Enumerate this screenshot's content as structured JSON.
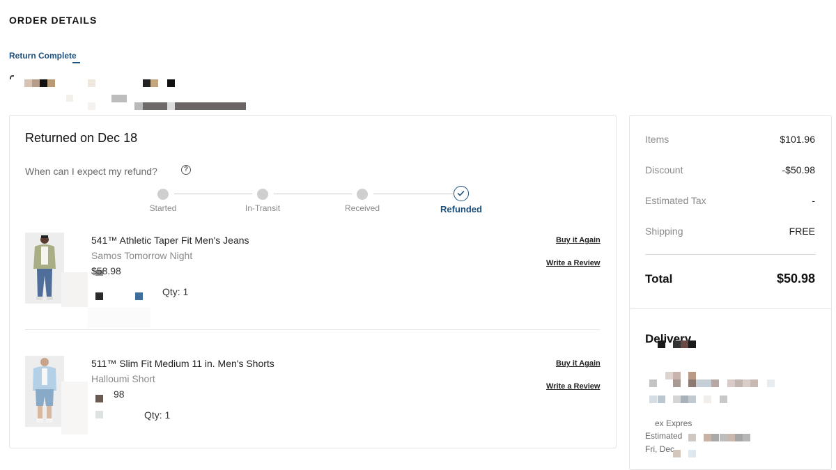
{
  "header": {
    "title": "ORDER DETAILS",
    "status_link": "Return Complete"
  },
  "return_panel": {
    "title": "Returned on Dec 18",
    "refund_question": "When can I expect my refund?",
    "help_icon": "question-circle-icon",
    "steps": [
      {
        "label": "Started",
        "complete": true
      },
      {
        "label": "In-Transit",
        "complete": true
      },
      {
        "label": "Received",
        "complete": true
      },
      {
        "label": "Refunded",
        "complete": true,
        "active": true
      }
    ]
  },
  "items": [
    {
      "name": "541™ Athletic Taper Fit Men's Jeans",
      "color": "Samos Tomorrow Night",
      "price": "$58.98",
      "qty": "Qty: 1",
      "buy_again": "Buy it Again",
      "review": "Write a Review"
    },
    {
      "name": "511™ Slim Fit Medium 11 in. Men's Shorts",
      "color": "Halloumi Short",
      "price": "98",
      "qty": "Qty: 1",
      "buy_again": "Buy it Again",
      "review": "Write a Review"
    }
  ],
  "summary": {
    "items_label": "Items",
    "items_value": "$101.96",
    "discount_label": "Discount",
    "discount_value": "-$50.98",
    "tax_label": "Estimated Tax",
    "tax_value": "-",
    "shipping_label": "Shipping",
    "shipping_value": "FREE",
    "total_label": "Total",
    "total_value": "$50.98"
  },
  "delivery": {
    "title": "Delivery",
    "carrier": "ex Expres",
    "estimated": "Estimated",
    "date": "Fri, Dec"
  },
  "colors": {
    "accent": "#1d4f7c",
    "border": "#e3e3e3",
    "muted": "#8a8a8a"
  }
}
